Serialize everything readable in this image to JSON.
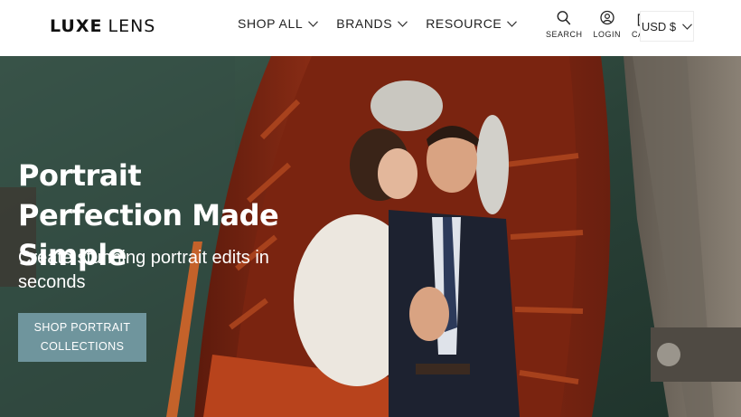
{
  "brand": {
    "logo_bold": "LUXE",
    "logo_light": "LENS"
  },
  "nav": [
    {
      "label": "SHOP ALL"
    },
    {
      "label": "BRANDS"
    },
    {
      "label": "RESOURCE"
    }
  ],
  "tools": {
    "search": {
      "label": "SEARCH",
      "icon": "search-icon"
    },
    "login": {
      "label": "LOGIN",
      "icon": "user-icon"
    },
    "cart": {
      "label": "CART",
      "icon": "bag-icon"
    }
  },
  "currency": {
    "value": "USD $"
  },
  "hero": {
    "title": "Portrait Perfection Made Simple",
    "subtitle": "Create stunning portrait edits in seconds",
    "cta": "SHOP PORTRAIT COLLECTIONS"
  },
  "colors": {
    "cta_background": "#6f959d",
    "boat_wood": "#8e2a14",
    "water": "#2f4a3f"
  }
}
